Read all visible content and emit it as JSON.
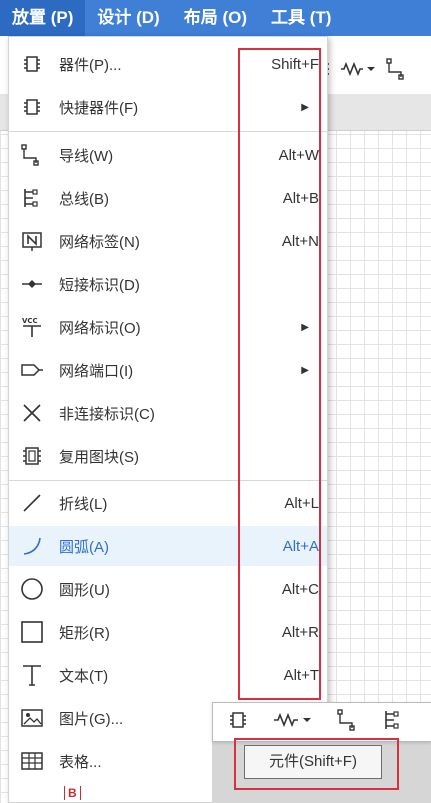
{
  "menubar": {
    "items": [
      {
        "label": "放置 (P)",
        "active": true
      },
      {
        "label": "设计 (D)",
        "active": false
      },
      {
        "label": "布局 (O)",
        "active": false
      },
      {
        "label": "工具 (T)",
        "active": false
      }
    ]
  },
  "place_menu": {
    "items": [
      {
        "icon": "chip-icon",
        "label": "器件(P)...",
        "shortcut": "Shift+F"
      },
      {
        "icon": "chip-icon",
        "label": "快捷器件(F)",
        "submenu": true
      },
      {
        "icon": "wire-icon",
        "label": "导线(W)",
        "shortcut": "Alt+W"
      },
      {
        "icon": "bus-icon",
        "label": "总线(B)",
        "shortcut": "Alt+B"
      },
      {
        "icon": "net-label-icon",
        "label": "网络标签(N)",
        "shortcut": "Alt+N"
      },
      {
        "icon": "short-flag-icon",
        "label": "短接标识(D)"
      },
      {
        "icon": "vcc-icon",
        "label": "网络标识(O)",
        "submenu": true
      },
      {
        "icon": "net-port-icon",
        "label": "网络端口(I)",
        "submenu": true
      },
      {
        "icon": "no-connect-icon",
        "label": "非连接标识(C)"
      },
      {
        "icon": "reuse-block-icon",
        "label": "复用图块(S)"
      },
      {
        "icon": "polyline-icon",
        "label": "折线(L)",
        "shortcut": "Alt+L"
      },
      {
        "icon": "arc-icon",
        "label": "圆弧(A)",
        "shortcut": "Alt+A",
        "highlight": true
      },
      {
        "icon": "circle-icon",
        "label": "圆形(U)",
        "shortcut": "Alt+C"
      },
      {
        "icon": "rectangle-icon",
        "label": "矩形(R)",
        "shortcut": "Alt+R"
      },
      {
        "icon": "text-icon",
        "label": "文本(T)",
        "shortcut": "Alt+T"
      },
      {
        "icon": "image-icon",
        "label": "图片(G)..."
      },
      {
        "icon": "table-icon",
        "label": "表格..."
      }
    ],
    "submenu_glyph": "▶"
  },
  "mini_toolbar": {
    "buttons": [
      "chip-icon",
      "resistor-icon",
      "wire-icon",
      "bus-icon"
    ],
    "dropdown_glyph": "▾"
  },
  "tooltip": {
    "text": "元件(Shift+F)"
  },
  "canvas_pin_label": "B",
  "colors": {
    "menubar": "#3f7fd6",
    "highlight_text": "#2f6fd0",
    "highlight_bg": "#e9f3fc",
    "annotation": "#d83040"
  }
}
